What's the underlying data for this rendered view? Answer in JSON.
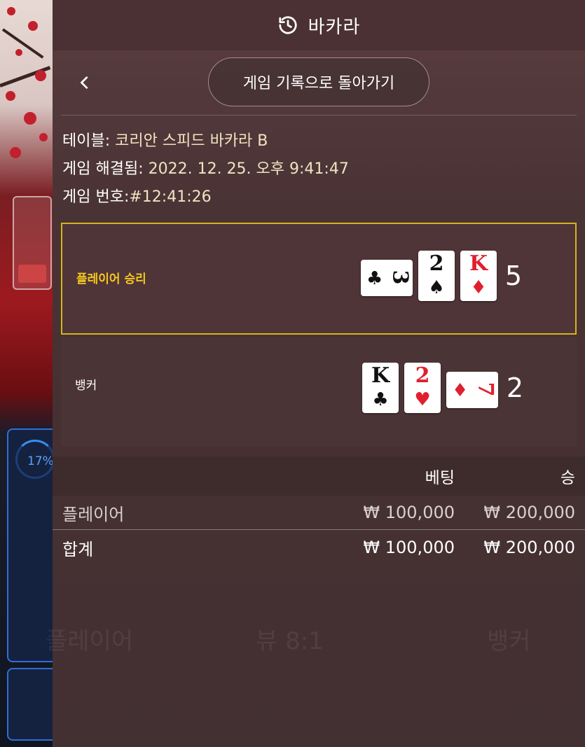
{
  "header": {
    "title": "바카라",
    "icon": "history-icon"
  },
  "nav": {
    "back_icon": "chevron-left-icon",
    "back_to_history": "게임 기록으로 돌아가기"
  },
  "info": {
    "table_label": "테이블:",
    "table_value": "코리안 스피드 바카라 B",
    "resolved_label": "게임 해결됨:",
    "resolved_value": "2022. 12. 25. 오후 9:41:47",
    "game_no_label": "게임 번호:",
    "game_no_value": "#12:41:26"
  },
  "player": {
    "label": "플레이어 승리",
    "score": "5",
    "cards": [
      {
        "rank": "3",
        "suit": "♣",
        "color": "black",
        "orientation": "sideways"
      },
      {
        "rank": "2",
        "suit": "♠",
        "color": "black",
        "orientation": "upright"
      },
      {
        "rank": "K",
        "suit": "♦",
        "color": "red",
        "orientation": "upright"
      }
    ],
    "highlight_color": "#d4b51a"
  },
  "banker": {
    "label": "뱅커",
    "score": "2",
    "cards": [
      {
        "rank": "K",
        "suit": "♣",
        "color": "black",
        "orientation": "upright"
      },
      {
        "rank": "2",
        "suit": "♥",
        "color": "red",
        "orientation": "upright"
      },
      {
        "rank": "7",
        "suit": "♦",
        "color": "red",
        "orientation": "sideways"
      }
    ]
  },
  "bets": {
    "col_bet": "베팅",
    "col_win": "승",
    "rows": [
      {
        "name": "플레이어",
        "bet": "₩ 100,000",
        "win": "₩ 200,000"
      }
    ],
    "total": {
      "name": "합계",
      "bet": "₩ 100,000",
      "win": "₩ 200,000"
    }
  },
  "background": {
    "progress_percent": "17%",
    "ghost_labels": [
      "플레이어",
      "뷰 8:1",
      "뱅커"
    ]
  }
}
